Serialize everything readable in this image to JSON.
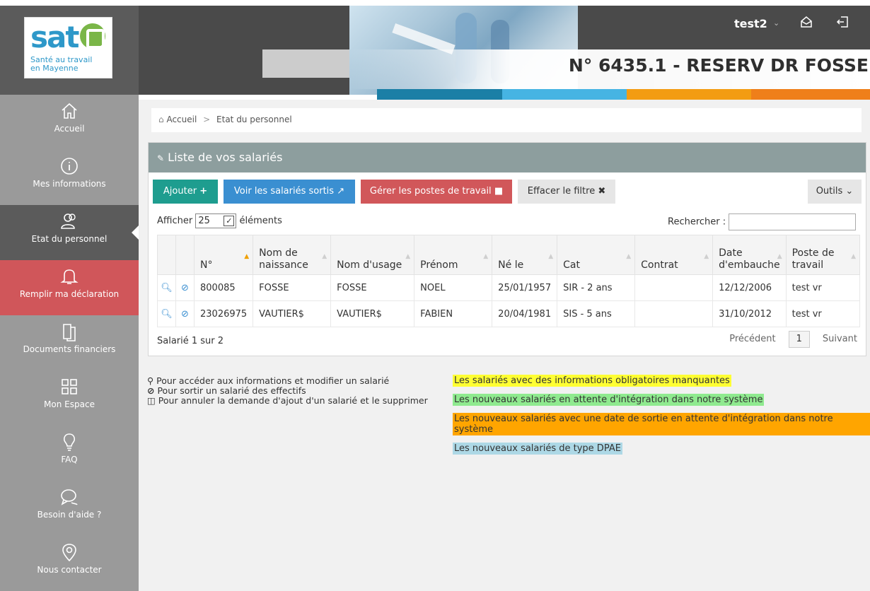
{
  "colors": {
    "accent_teal": "#1e9d8f",
    "accent_blue": "#3a8fd1",
    "accent_red": "#d1575a",
    "sidebar": "#9a9a9a",
    "sidebar_active": "#5b5b5b"
  },
  "logo": {
    "word": "sat",
    "subtitle_line1": "Santé au travail",
    "subtitle_line2": "en Mayenne"
  },
  "header": {
    "user": "test2",
    "account_title": "N° 6435.1 - RESERV DR FOSSE"
  },
  "sidebar": {
    "items": [
      {
        "label": "Accueil",
        "icon": "home-icon"
      },
      {
        "label": "Mes informations",
        "icon": "info-icon"
      },
      {
        "label": "Etat du personnel",
        "icon": "people-icon"
      },
      {
        "label": "Remplir ma déclaration",
        "icon": "bell-icon"
      },
      {
        "label": "Documents financiers",
        "icon": "documents-icon"
      },
      {
        "label": "Mon Espace",
        "icon": "grid-icon"
      },
      {
        "label": "FAQ",
        "icon": "lightbulb-icon"
      },
      {
        "label": "Besoin d'aide ?",
        "icon": "chat-icon"
      },
      {
        "label": "Nous contacter",
        "icon": "location-icon"
      }
    ]
  },
  "breadcrumb": {
    "home": "Accueil",
    "current": "Etat du personnel"
  },
  "panel": {
    "title": "Liste de vos salariés"
  },
  "toolbar": {
    "add": "Ajouter",
    "sortis": "Voir les salariés sortis",
    "postes": "Gérer les postes de travail",
    "filtre": "Effacer le filtre",
    "outils": "Outils"
  },
  "table_controls": {
    "show_prefix": "Afficher",
    "show_value": "25",
    "show_suffix": "éléments",
    "search_label": "Rechercher :"
  },
  "table": {
    "headers": [
      "N°",
      "Nom de naissance",
      "Nom d'usage",
      "Prénom",
      "Né le",
      "Cat",
      "Contrat",
      "Date d'embauche",
      "Poste de travail"
    ],
    "rows": [
      [
        "800085",
        "FOSSE",
        "FOSSE",
        "NOEL",
        "25/01/1957",
        "SIR - 2 ans",
        "",
        "12/12/2006",
        "test vr"
      ],
      [
        "23026975",
        "VAUTIER$",
        "VAUTIER$",
        "FABIEN",
        "20/04/1981",
        "SIS - 5 ans",
        "",
        "31/10/2012",
        "test vr"
      ]
    ]
  },
  "footer": {
    "info": "Salarié 1 sur 2",
    "prev": "Précédent",
    "page": "1",
    "next": "Suivant"
  },
  "legend_left": [
    "Pour accéder aux informations et modifier un salarié",
    "Pour sortir un salarié des effectifs",
    "Pour annuler la demande d'ajout d'un salarié et le supprimer"
  ],
  "legend_right": [
    {
      "text": "Les salariés avec des informations obligatoires manquantes",
      "color": "#ffff33"
    },
    {
      "text": "Les nouveaux salariés en attente d'intégration dans notre système",
      "color": "#8fea8f"
    },
    {
      "text": "Les nouveaux salariés avec une date de sortie en attente d'intégration dans notre système",
      "color": "#ffa500"
    },
    {
      "text": "Les nouveaux salariés de type DPAE",
      "color": "#add8e6"
    }
  ]
}
